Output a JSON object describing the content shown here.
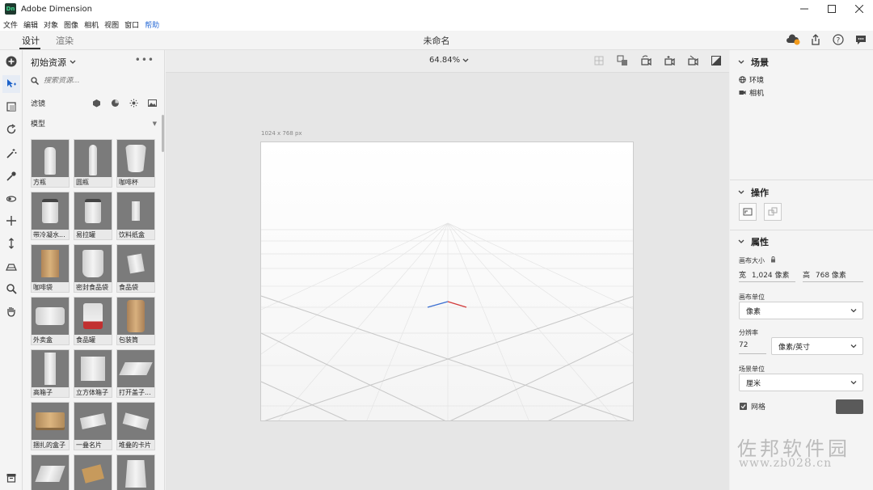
{
  "window": {
    "title": "Adobe Dimension",
    "logo_text": "Dn"
  },
  "menu": [
    "文件",
    "编辑",
    "对象",
    "图像",
    "相机",
    "视图",
    "窗口",
    "帮助"
  ],
  "modes": {
    "design": "设计",
    "render": "渲染"
  },
  "document_title": "未命名",
  "assets": {
    "title": "初始资源",
    "search_placeholder": "搜索资源...",
    "filter_label": "滤镜",
    "section": "模型",
    "items": [
      "方瓶",
      "圆瓶",
      "咖啡杯",
      "带冷凝水...",
      "易拉罐",
      "饮料纸盒",
      "咖啡袋",
      "密封食品袋",
      "食品袋",
      "外卖盒",
      "食品罐",
      "包装筒",
      "高箱子",
      "立方体箱子",
      "打开盖子...",
      "捆扎的盒子",
      "一叠名片",
      "堆叠的卡片",
      "",
      "",
      ""
    ]
  },
  "canvas": {
    "zoom": "64.84%",
    "size_label": "1024 x 768 px"
  },
  "scene": {
    "title": "场景",
    "items": [
      "环境",
      "相机"
    ]
  },
  "actions": {
    "title": "操作"
  },
  "properties": {
    "title": "属性",
    "canvas_size_label": "画布大小",
    "width_label": "宽",
    "width_value": "1,024 像素",
    "height_label": "高",
    "height_value": "768 像素",
    "canvas_unit_label": "画布单位",
    "canvas_unit_value": "像素",
    "resolution_label": "分辨率",
    "resolution_value": "72",
    "resolution_unit": "像素/英寸",
    "scene_unit_label": "场景单位",
    "scene_unit_value": "厘米",
    "grid_label": "网格",
    "grid_color": "#5a5a5a"
  },
  "watermark": {
    "line1": "佐邦软件园",
    "line2": "www.zb028.cn"
  }
}
